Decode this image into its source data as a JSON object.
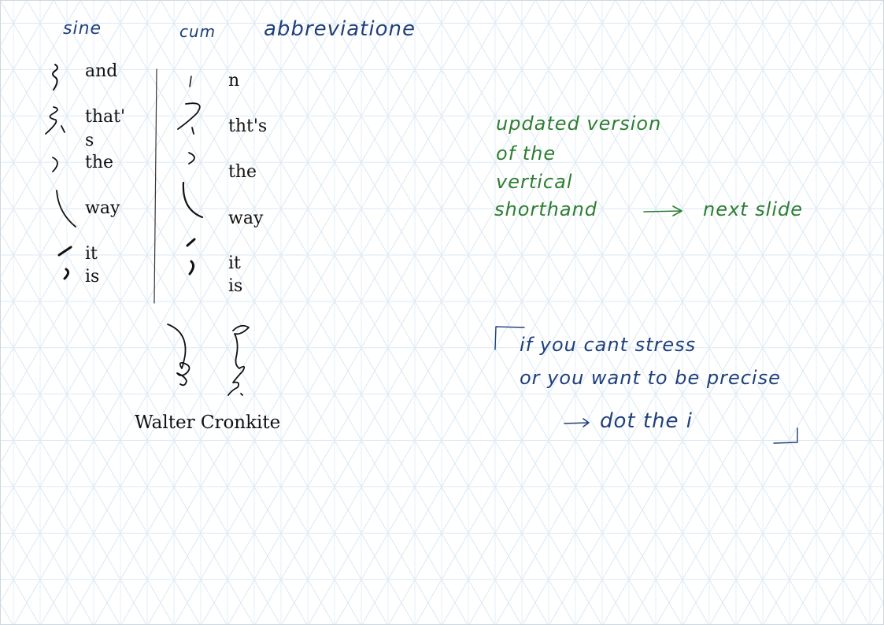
{
  "headers": {
    "left": "sine",
    "right_1": "cum",
    "right_2": "abbreviatione"
  },
  "left_column": {
    "words": [
      "and",
      "that'",
      "s",
      "the",
      "way",
      "it",
      "is"
    ]
  },
  "right_column": {
    "words": [
      "n",
      "tht's",
      "the",
      "way",
      "it",
      "is"
    ]
  },
  "caption": "Walter Cronkite",
  "green_note": {
    "lines": [
      "updated version",
      "of the",
      "vertical",
      "shorthand"
    ],
    "arrow_text": "next slide"
  },
  "blue_note": {
    "lines": [
      "if you cant stress",
      "or you want to be precise"
    ],
    "arrow_text": "dot the i"
  },
  "colors": {
    "ink_blue": "#1f3f7a",
    "ink_green": "#2e7d32",
    "ink_black": "#111111",
    "grid": "#d6e6f2"
  }
}
